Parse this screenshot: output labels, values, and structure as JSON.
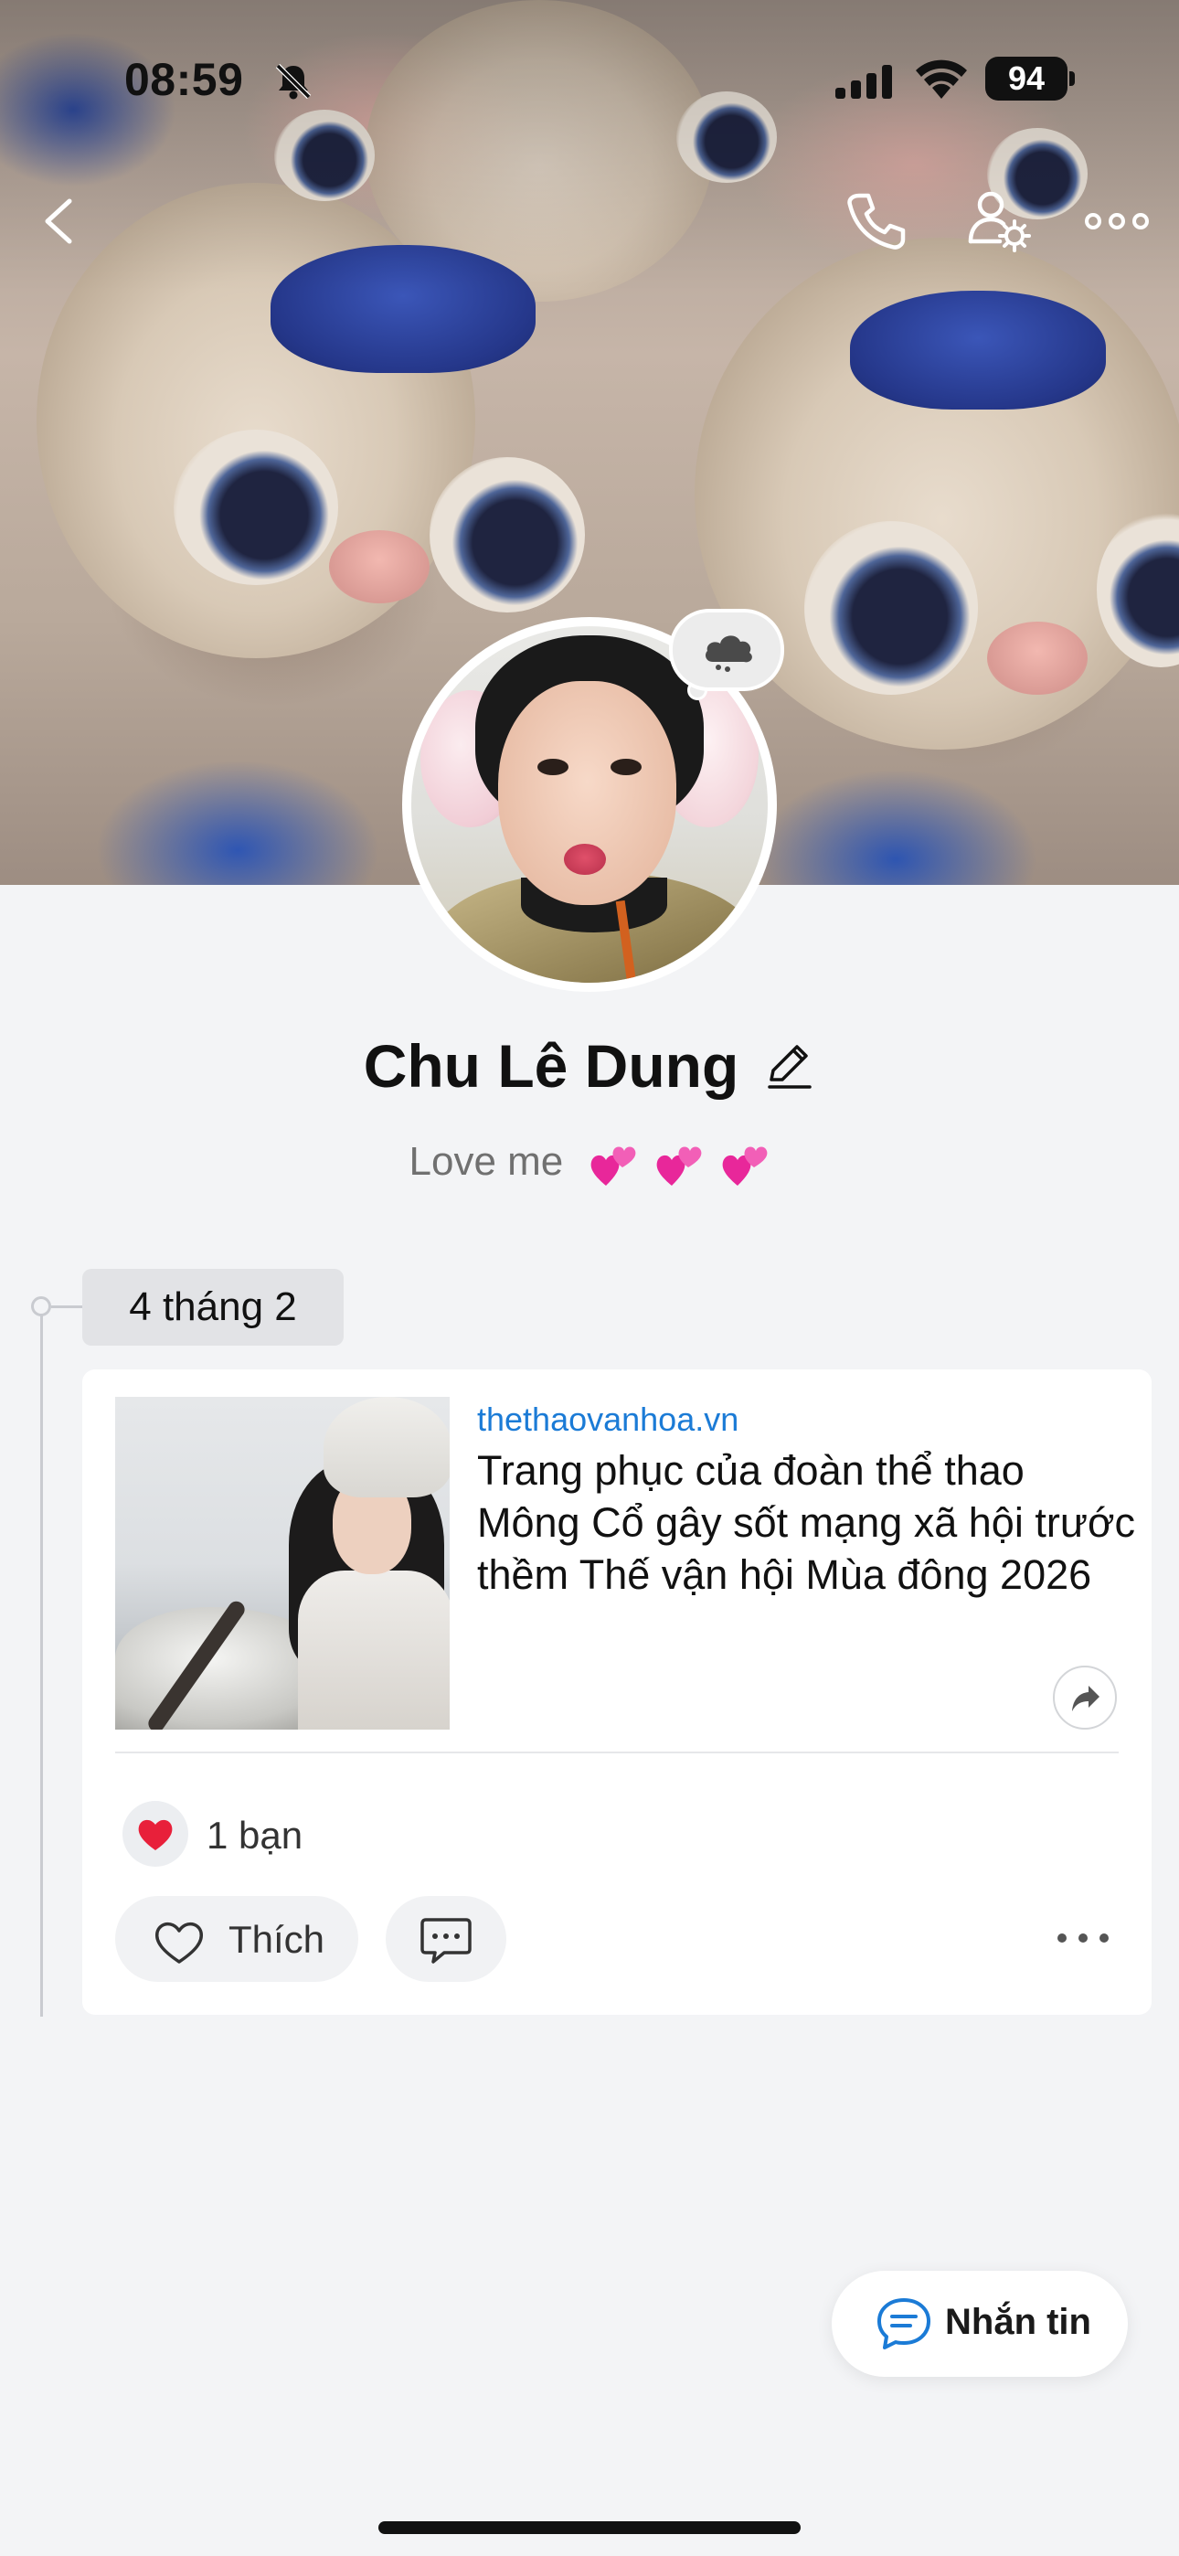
{
  "status_bar": {
    "time": "08:59",
    "battery": "94"
  },
  "header": {
    "back_icon": "chevron-left-icon",
    "call_icon": "phone-icon",
    "settings_icon": "user-gear-icon",
    "more_icon": "ellipsis-icon"
  },
  "profile": {
    "name": "Chu Lê Dung",
    "status": "Love me",
    "status_emojis": [
      "heart-emoji",
      "heart-emoji",
      "heart-emoji"
    ]
  },
  "timeline": {
    "date": "4 tháng 2"
  },
  "post": {
    "link_domain": "thethaovanhoa.vn",
    "link_title": "Trang phục của đoàn thể thao Mông Cổ gây sốt mạng xã hội trước thềm Thế vận hội Mùa đông 2026",
    "reaction_summary": "1 bạn",
    "like_label": "Thích"
  },
  "fab": {
    "label": "Nhắn tin"
  },
  "colors": {
    "link_blue": "#1b7bd6",
    "background": "#f3f4f6",
    "heart_red": "#e8203a"
  }
}
